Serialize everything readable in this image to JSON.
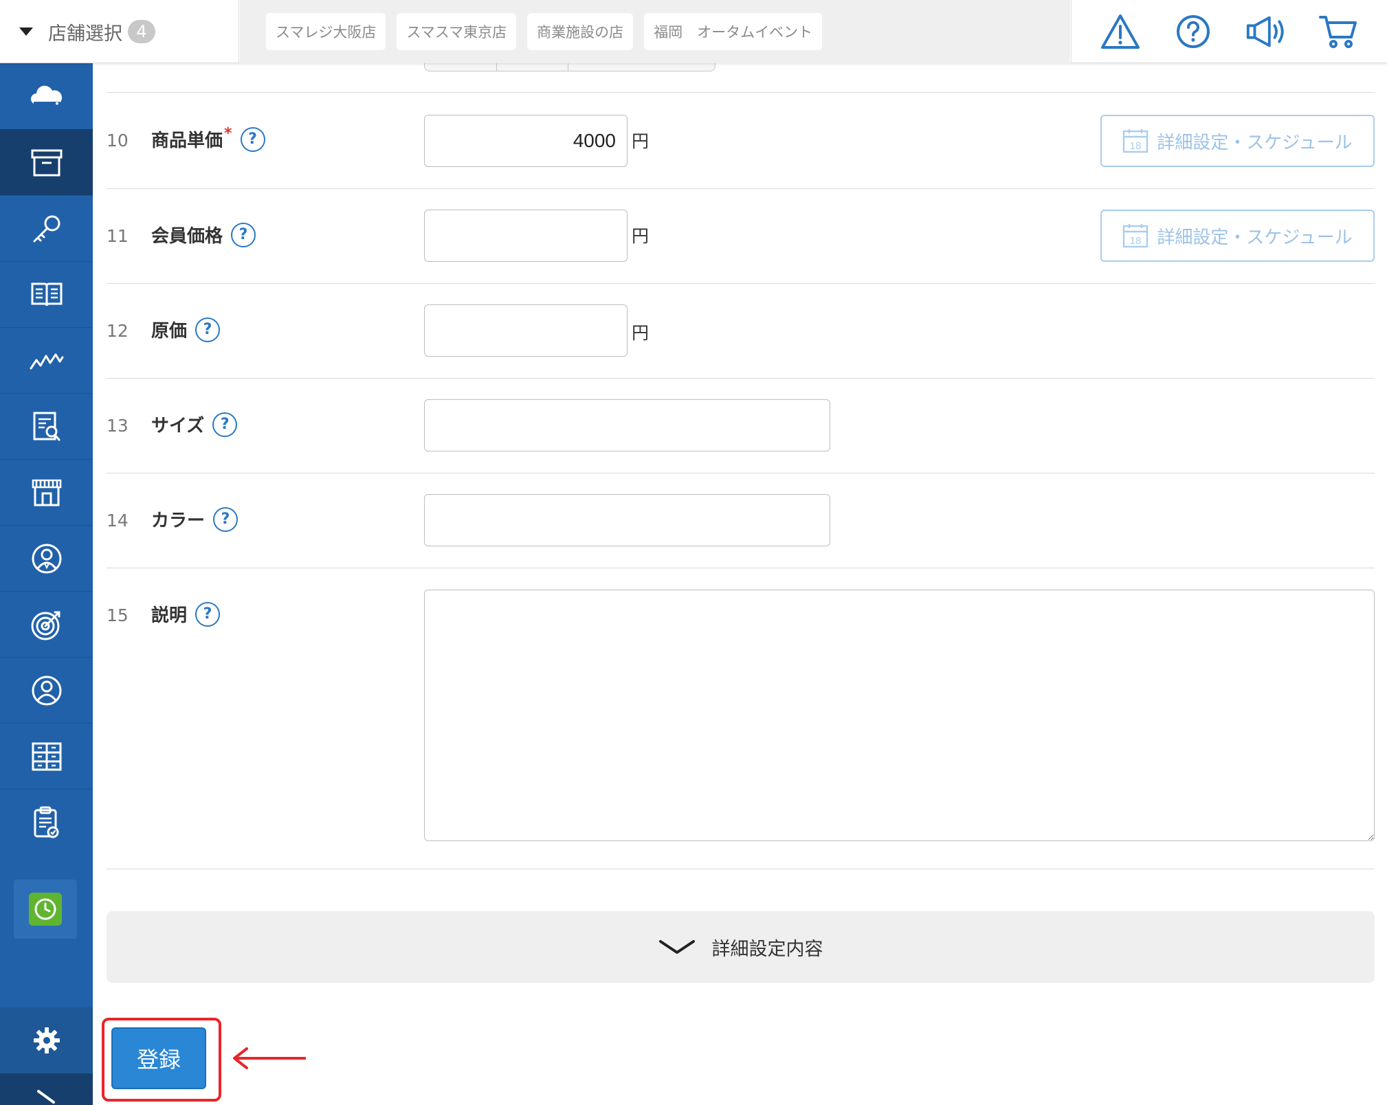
{
  "header": {
    "store_select_label": "店舗選択",
    "store_count": "4",
    "stores": [
      "スマレジ大阪店",
      "スマスマ東京店",
      "商業施設の店",
      "福岡　オータムイベント"
    ]
  },
  "form": {
    "rows": [
      {
        "num": "10",
        "label": "商品単価",
        "value": "4000",
        "unit": "円",
        "schedule": "詳細設定・スケジュール"
      },
      {
        "num": "11",
        "label": "会員価格",
        "value": "",
        "unit": "円",
        "schedule": "詳細設定・スケジュール"
      },
      {
        "num": "12",
        "label": "原価",
        "value": "",
        "unit": "円"
      },
      {
        "num": "13",
        "label": "サイズ",
        "value": ""
      },
      {
        "num": "14",
        "label": "カラー",
        "value": ""
      },
      {
        "num": "15",
        "label": "説明",
        "value": ""
      }
    ],
    "required_mark": "*",
    "help_glyph": "?",
    "calendar_day": "18"
  },
  "detail_toggle_label": "詳細設定内容",
  "register_label": "登録",
  "colors": {
    "sidebar": "#2161a9",
    "sidebar_active": "#163f6e",
    "accent": "#2a87d6",
    "highlight": "#e8262a",
    "clock_green": "#5fb52f"
  }
}
